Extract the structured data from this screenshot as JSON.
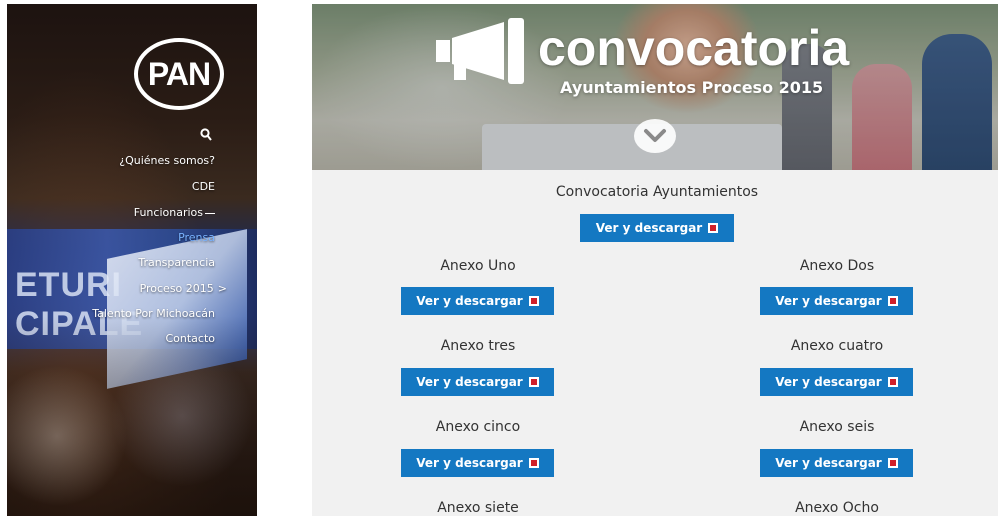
{
  "sidebar": {
    "logo_text": "PAN",
    "banner_text": "ETURI CIPALE",
    "nav": [
      {
        "label": "¿Quiénes somos?"
      },
      {
        "label": "CDE"
      },
      {
        "label": "Funcionarios"
      },
      {
        "label": "Prensa"
      },
      {
        "label": "Transparencia"
      },
      {
        "label": "Proceso 2015",
        "chevron": ">"
      },
      {
        "label": "Talento Por Michoacán"
      },
      {
        "label": "Contacto"
      }
    ]
  },
  "hero": {
    "title": "convocatoria",
    "subtitle": "Ayuntamientos Proceso 2015"
  },
  "content": {
    "main_title": "Convocatoria Ayuntamientos",
    "button_label": "Ver y descargar",
    "anexos": [
      {
        "label": "Anexo Uno"
      },
      {
        "label": "Anexo Dos"
      },
      {
        "label": "Anexo tres"
      },
      {
        "label": "Anexo cuatro"
      },
      {
        "label": "Anexo cinco"
      },
      {
        "label": "Anexo seis"
      },
      {
        "label": "Anexo siete"
      },
      {
        "label": "Anexo Ocho"
      }
    ]
  },
  "colors": {
    "button": "#1478c2",
    "active_nav": "#79b3ff",
    "content_bg": "#f1f1f1"
  }
}
